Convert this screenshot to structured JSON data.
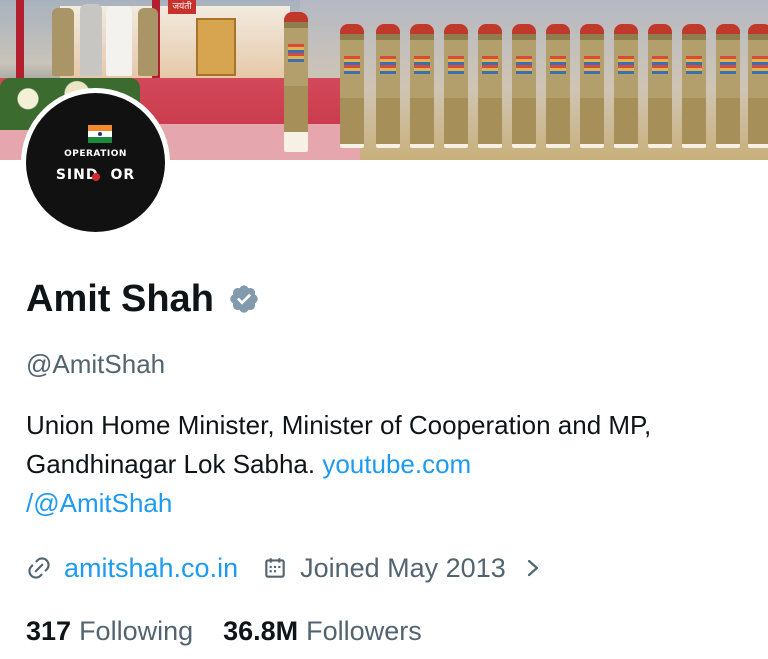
{
  "banner": {
    "sign_text": "जयंती"
  },
  "avatar": {
    "line1": "OPERATION",
    "line2_prefix": "SIND",
    "line2_suffix": "OR"
  },
  "profile": {
    "name": "Amit Shah",
    "handle": "@AmitShah",
    "verified_color": "#829aab",
    "bio_text": "Union Home Minister, Minister of Cooperation and MP, Gandhinagar Lok Sabha. ",
    "bio_link_line1": "youtube.com",
    "bio_link_line2": "/@AmitShah",
    "website": "amitshah.co.in",
    "joined": "Joined May 2013"
  },
  "stats": {
    "following_count": "317",
    "following_label": "Following",
    "followers_count": "36.8M",
    "followers_label": "Followers"
  },
  "colors": {
    "link": "#1d9bf0",
    "secondary_text": "#536471",
    "primary_text": "#0f1419"
  },
  "icons": [
    "link-icon",
    "calendar-icon",
    "chevron-right-icon",
    "verified-badge-icon"
  ]
}
